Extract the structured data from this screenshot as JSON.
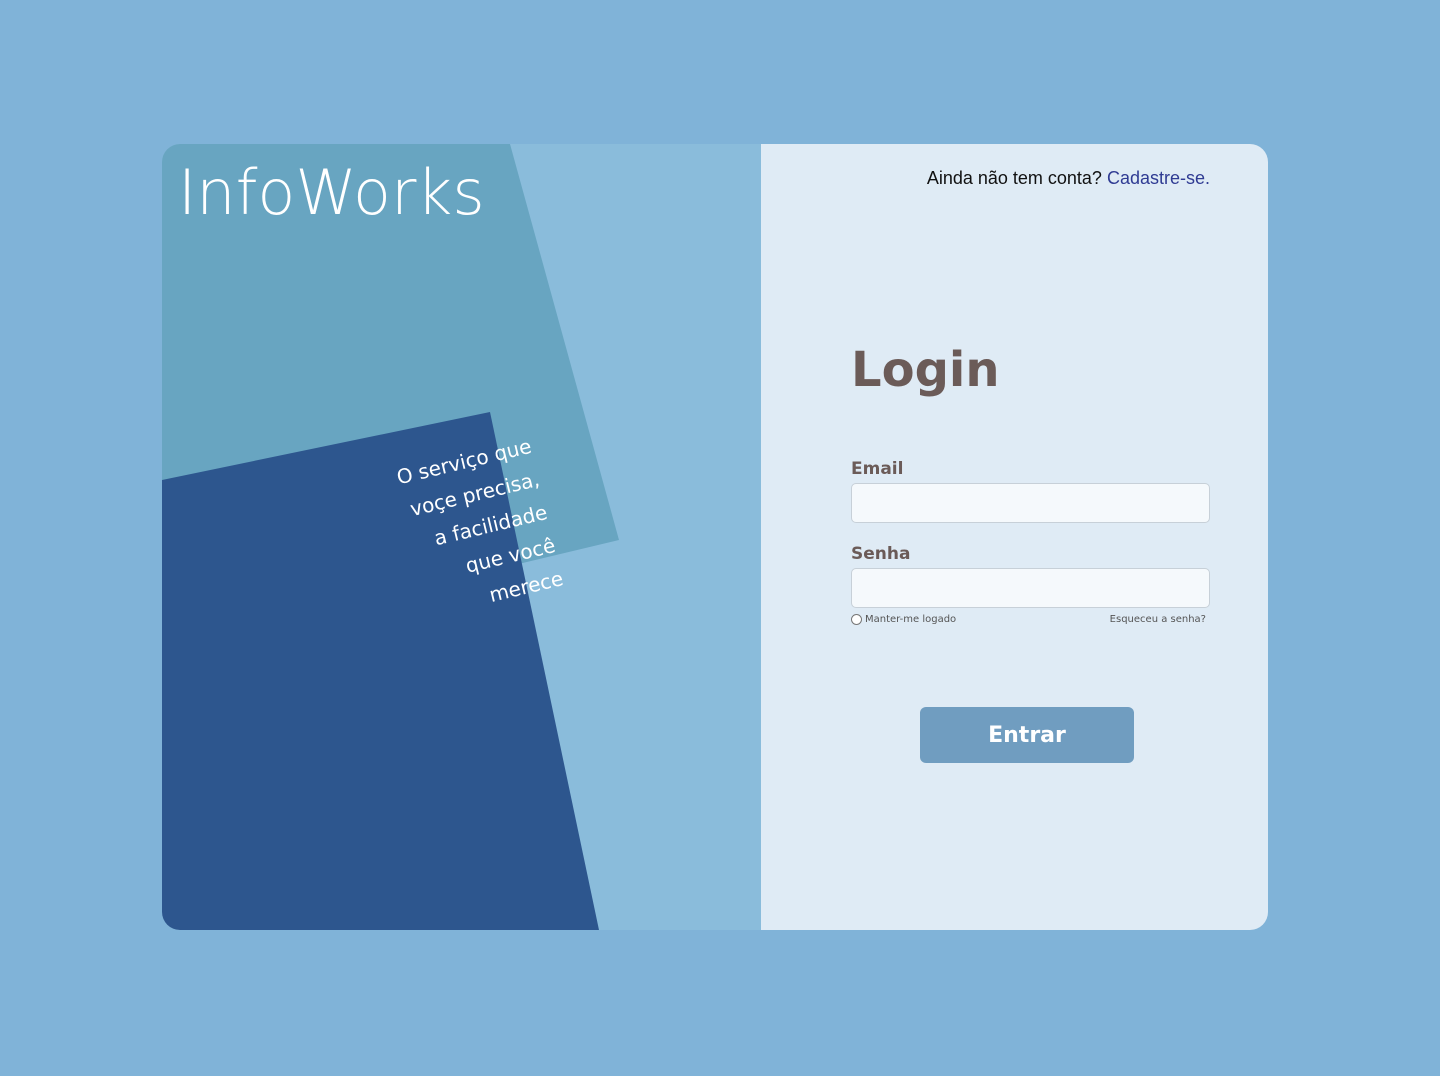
{
  "brand": {
    "name": "InfoWorks",
    "tagline": [
      "O serviço que",
      "voçe precisa,",
      "a facilidade",
      "que você",
      "merece"
    ]
  },
  "header": {
    "signup_prompt": "Ainda não tem conta?",
    "signup_link": "Cadastre-se."
  },
  "form": {
    "title": "Login",
    "email_label": "Email",
    "email_value": "",
    "password_label": "Senha",
    "password_value": "",
    "remember_label": "Manter-me logado",
    "forgot_label": "Esqueceu a senha?",
    "submit_label": "Entrar"
  },
  "colors": {
    "background": "#80b3d8",
    "panel_light_blue": "#8abcdb",
    "panel_teal": "#68a5c1",
    "panel_navy": "#2d568e",
    "form_bg": "#dfebf5",
    "title_color": "#6b5b58",
    "link_color": "#2f3b93",
    "button_bg": "#709dc0"
  }
}
